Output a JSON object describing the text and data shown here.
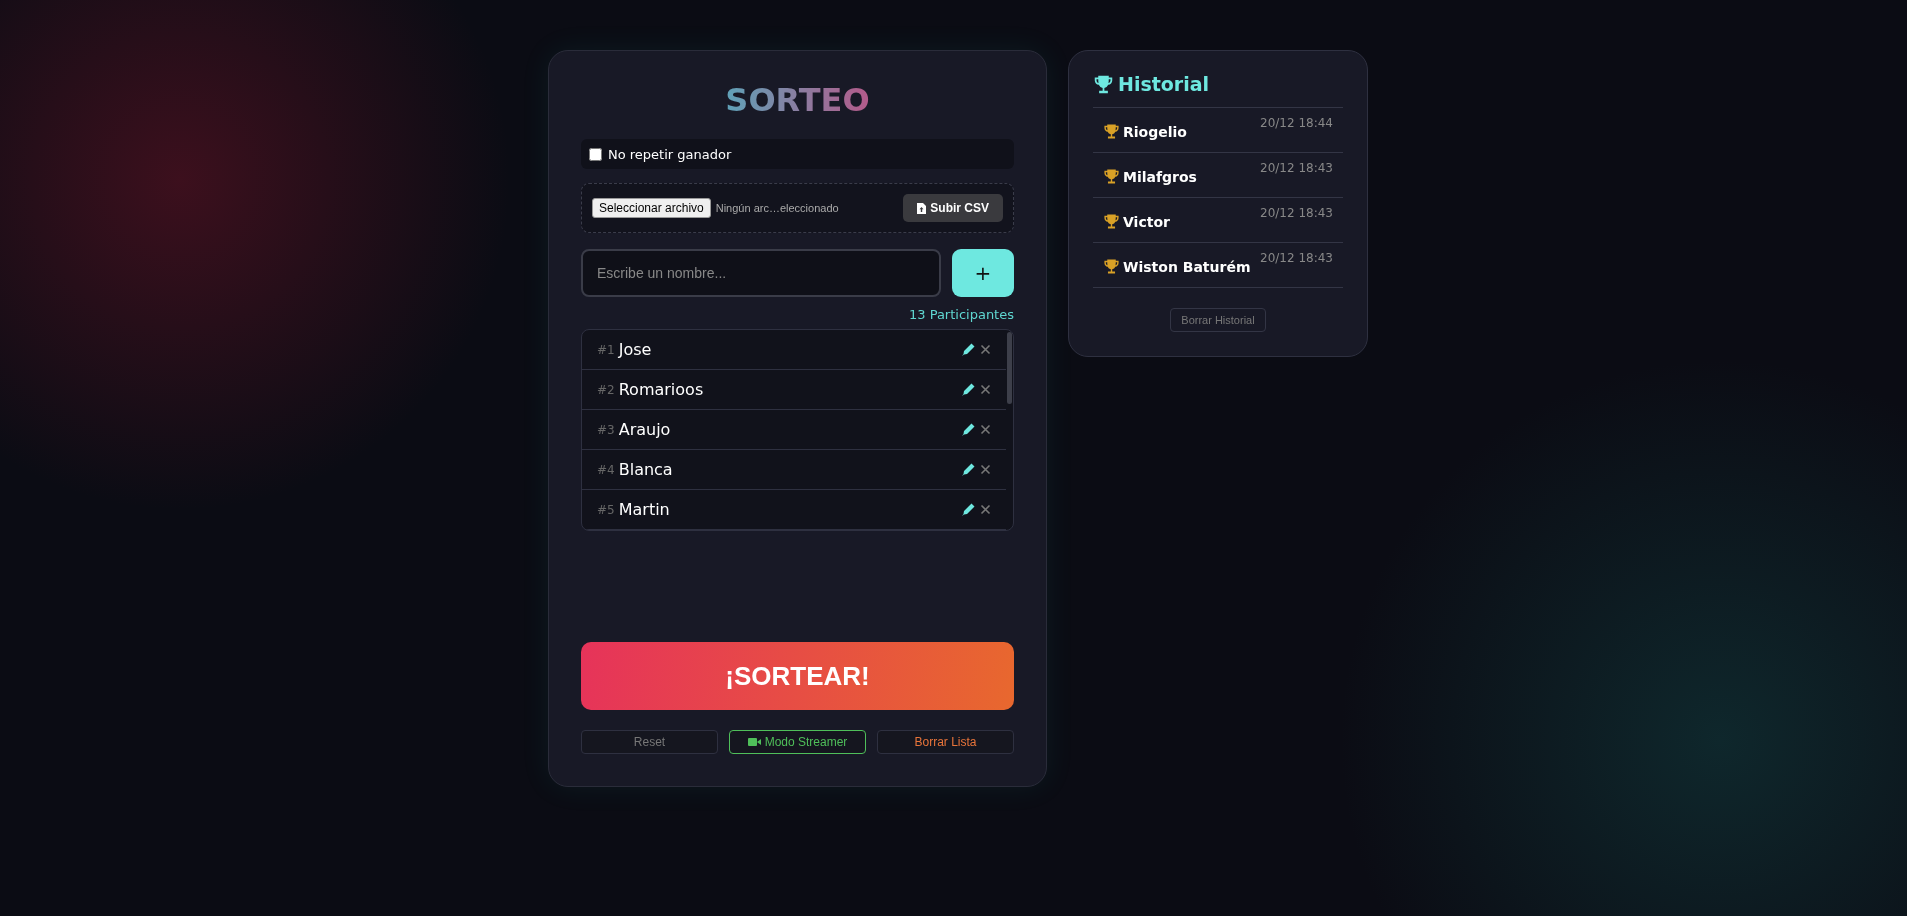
{
  "title": "SORTEO",
  "no_repeat": {
    "label": "No repetir ganador",
    "checked": false
  },
  "file_upload": {
    "choose_button": "Seleccionar archivo",
    "file_status": "Ningún arc…eleccionado",
    "upload_button": "Subir CSV"
  },
  "name_input": {
    "placeholder": "Escribe un nombre..."
  },
  "add_button": "+",
  "participant_count": "13 Participantes",
  "participants": [
    {
      "number": "#1",
      "name": "Jose"
    },
    {
      "number": "#2",
      "name": "Romarioos"
    },
    {
      "number": "#3",
      "name": "Araujo"
    },
    {
      "number": "#4",
      "name": "Blanca"
    },
    {
      "number": "#5",
      "name": "Martin"
    }
  ],
  "draw_button": "¡SORTEAR!",
  "actions": [
    {
      "kind": "reset",
      "label": "Reset"
    },
    {
      "kind": "streamer",
      "label": "Modo Streamer"
    },
    {
      "kind": "danger",
      "label": "Borrar Lista"
    }
  ],
  "history": {
    "title": "Historial",
    "entries": [
      {
        "name": "Riogelio",
        "time": "20/12 18:44"
      },
      {
        "name": "Milafgros",
        "time": "20/12 18:43"
      },
      {
        "name": "Victor",
        "time": "20/12 18:43"
      },
      {
        "name": "Wiston Baturém",
        "time": "20/12 18:43"
      }
    ],
    "clear_button": "Borrar Historial"
  }
}
